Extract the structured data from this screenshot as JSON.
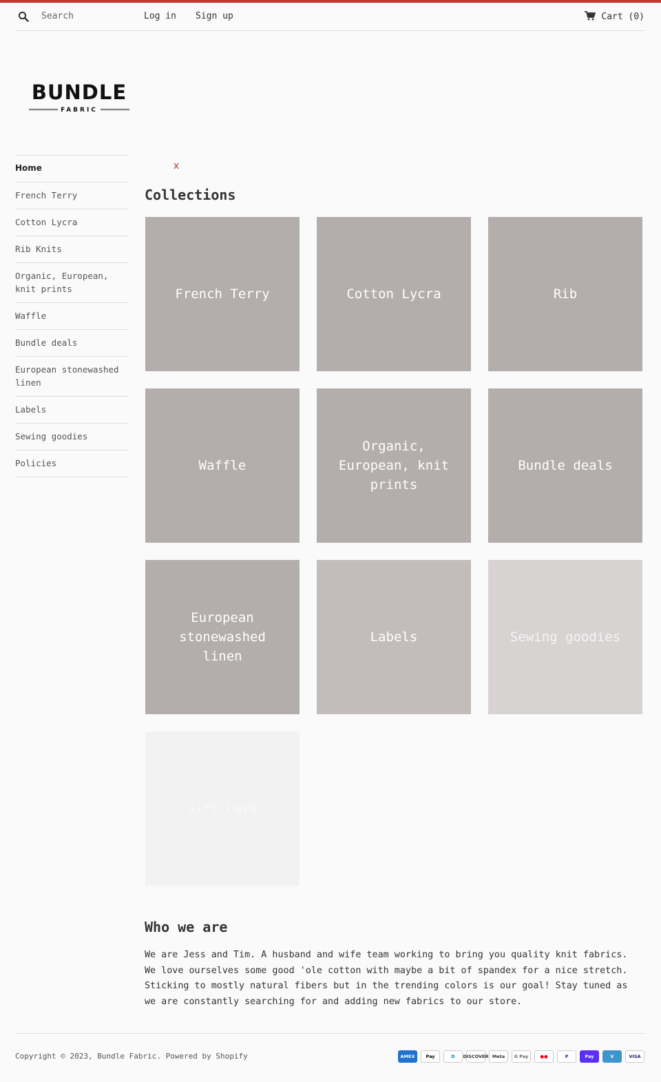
{
  "header": {
    "search_placeholder": "Search",
    "login": "Log in",
    "signup": "Sign up",
    "cart": "Cart (0)"
  },
  "logo": {
    "name": "BUNDLE",
    "sub": "FABRIC"
  },
  "sidebar": {
    "items": [
      {
        "label": "Home",
        "active": true
      },
      {
        "label": "French Terry"
      },
      {
        "label": "Cotton Lycra"
      },
      {
        "label": "Rib Knits"
      },
      {
        "label": "Organic, European, knit prints"
      },
      {
        "label": "Waffle"
      },
      {
        "label": "Bundle deals"
      },
      {
        "label": "European stonewashed linen"
      },
      {
        "label": "Labels"
      },
      {
        "label": "Sewing goodies"
      },
      {
        "label": "Policies"
      }
    ]
  },
  "collections": {
    "title": "Collections",
    "tiles": [
      {
        "label": "French Terry",
        "bg": "#b3adac",
        "fg": "#ffffff"
      },
      {
        "label": "Cotton Lycra",
        "bg": "#b3adac",
        "fg": "#ffffff"
      },
      {
        "label": "Rib",
        "bg": "#b3adac",
        "fg": "#ffffff"
      },
      {
        "label": "Waffle",
        "bg": "#b3adac",
        "fg": "#ffffff"
      },
      {
        "label": "Organic, European, knit prints",
        "bg": "#b3adac",
        "fg": "#ffffff"
      },
      {
        "label": "Bundle deals",
        "bg": "#b3adac",
        "fg": "#ffffff"
      },
      {
        "label": "European stonewashed linen",
        "bg": "#b3adac",
        "fg": "#ffffff"
      },
      {
        "label": "Labels",
        "bg": "#c2bcbb",
        "fg": "#ffffff"
      },
      {
        "label": "Sewing goodies",
        "bg": "#d7d3d2",
        "fg": "#f4f4f4"
      },
      {
        "label": "Gift Card",
        "bg": "#f2f2f2",
        "fg": "#f8f8f8"
      }
    ]
  },
  "about": {
    "title": "Who we are",
    "text": "We are Jess and Tim. A husband and wife team working to bring you quality knit fabrics. We love ourselves some good 'ole cotton with maybe a bit of spandex for a nice stretch. Sticking to mostly natural fibers but in the trending colors is our goal! Stay tuned as we are constantly searching for and adding new fabrics to our store."
  },
  "footer": {
    "copyright_prefix": "Copyright © 2023, ",
    "store_link": "Bundle Fabric",
    "separator": ". ",
    "powered": "Powered by Shopify",
    "payments": [
      {
        "label": "AMEX",
        "icon": "amex-icon",
        "bg": "#1f72cd",
        "fg": "#ffffff"
      },
      {
        "label": "Pay",
        "icon": "apple-pay-icon",
        "bg": "#ffffff",
        "fg": "#000000"
      },
      {
        "label": "D",
        "icon": "diners-club-icon",
        "bg": "#ffffff",
        "fg": "#0079be"
      },
      {
        "label": "DISCOVER",
        "icon": "discover-icon",
        "bg": "#ffffff",
        "fg": "#333333"
      },
      {
        "label": "Meta",
        "icon": "meta-pay-icon",
        "bg": "#ffffff",
        "fg": "#333333"
      },
      {
        "label": "G Pay",
        "icon": "google-pay-icon",
        "bg": "#ffffff",
        "fg": "#5f6368"
      },
      {
        "label": "●●",
        "icon": "mastercard-icon",
        "bg": "#ffffff",
        "fg": "#eb001b"
      },
      {
        "label": "P",
        "icon": "paypal-icon",
        "bg": "#ffffff",
        "fg": "#003087"
      },
      {
        "label": "Pay",
        "icon": "shop-pay-icon",
        "bg": "#5a31f4",
        "fg": "#ffffff"
      },
      {
        "label": "V",
        "icon": "venmo-icon",
        "bg": "#3d95ce",
        "fg": "#ffffff"
      },
      {
        "label": "VISA",
        "icon": "visa-icon",
        "bg": "#ffffff",
        "fg": "#1a1f71"
      }
    ]
  }
}
